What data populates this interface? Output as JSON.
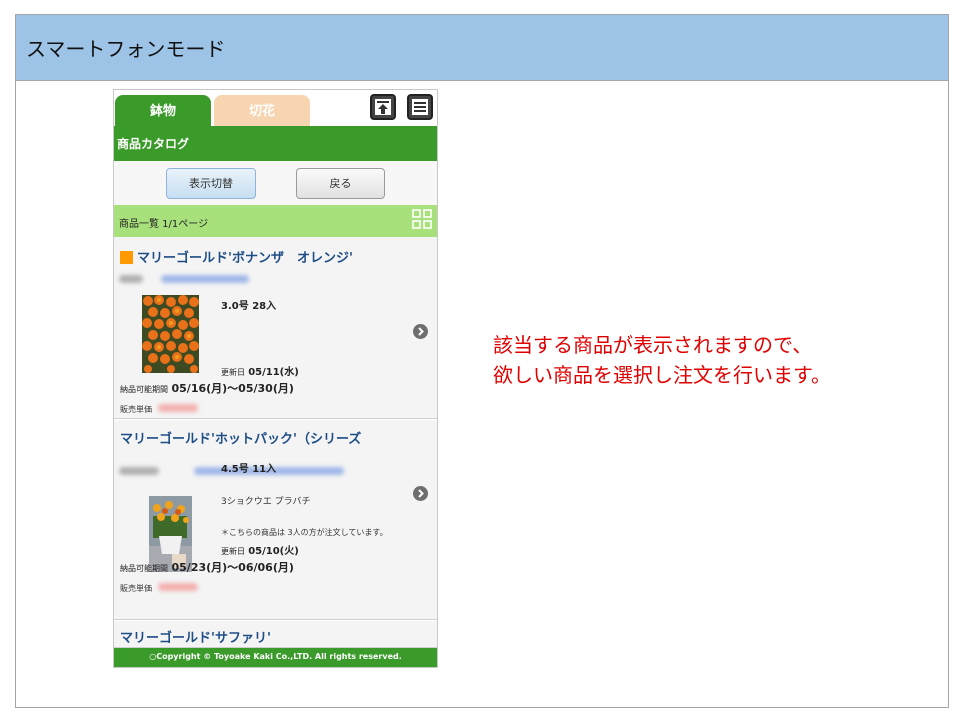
{
  "slide": {
    "title": "スマートフォンモード",
    "header_color": "#9dc3e6"
  },
  "phone": {
    "tabs": [
      {
        "label": "鉢物",
        "active": true,
        "color": "#3a9b2a"
      },
      {
        "label": "切花",
        "active": false,
        "color": "#f6d5b0"
      }
    ],
    "icons": {
      "top": "arrow-to-top-icon",
      "menu": "hamburger-menu-icon"
    },
    "catalog_title": "商品カタログ",
    "buttons": {
      "toggle": "表示切替",
      "back": "戻る"
    },
    "list_header": "商品一覧 1/1ページ",
    "view_icon": "grid-view-icon",
    "products": [
      {
        "title": "マリーゴールド'ボナンザ　オレンジ'",
        "marker_color": "#ff9900",
        "spec": "3.0号 28入",
        "updated_label": "更新日",
        "updated_value": "05/11(水)",
        "period_label": "納品可能期間",
        "period_value": "05/16(月)～05/30(月)",
        "price_label": "販売単価"
      },
      {
        "title": "マリーゴールド'ホットパック'（シリーズ",
        "spec": "4.5号 11入",
        "code": "3ショクウエ プラバチ",
        "note": "＊こちらの商品は 3人の方が注文しています。",
        "updated_label": "更新日",
        "updated_value": "05/10(火)",
        "period_label": "納品可能期間",
        "period_value": "05/23(月)～06/06(月)",
        "price_label": "販売単価"
      },
      {
        "title": "マリーゴールド'サファリ'"
      }
    ],
    "footer": "○Copyright © Toyoake Kaki Co.,LTD. All rights reserved."
  },
  "callout": {
    "line1": "該当する商品が表示されますので、",
    "line2": "欲しい商品を選択し注文を行います。",
    "color": "#e00000"
  }
}
